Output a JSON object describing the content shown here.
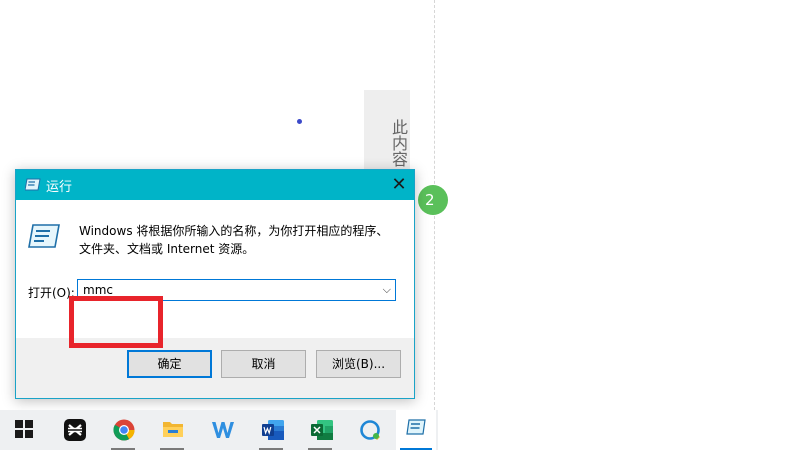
{
  "background": {
    "sidebar_text": "此内容",
    "badge_text": "2"
  },
  "dialog": {
    "title": "运行",
    "description": "Windows 将根据你所输入的名称，为你打开相应的程序、文件夹、文档或 Internet 资源。",
    "open_label": "打开(O):",
    "input_value": "mmc",
    "ok_label": "确定",
    "cancel_label": "取消",
    "browse_label": "浏览(B)..."
  },
  "taskbar": {
    "items": [
      "start",
      "capcut",
      "chrome",
      "file-explorer",
      "wps-writer",
      "word",
      "excel",
      "quick-assist",
      "run"
    ],
    "accent_color": "#0078d7"
  },
  "colors": {
    "titlebar": "#00b4c8",
    "highlight": "#e8242b"
  }
}
